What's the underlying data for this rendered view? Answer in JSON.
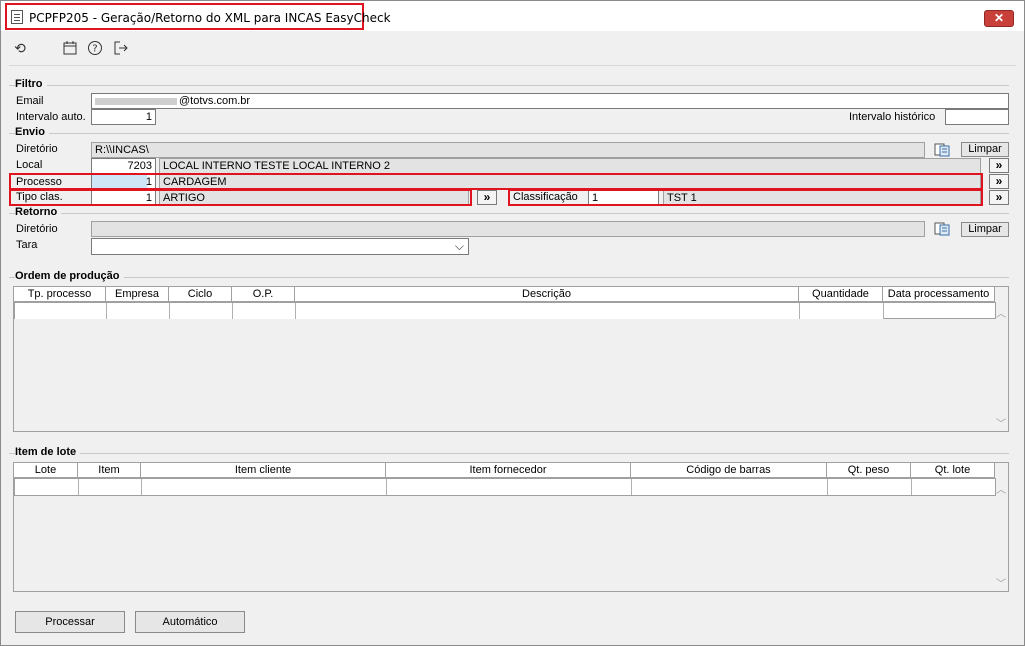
{
  "window": {
    "title": "PCPFP205 - Geração/Retorno do XML para INCAS EasyCheck"
  },
  "toolbar": {
    "refresh_icon": "refresh-icon",
    "calendar_icon": "calendar-icon",
    "help_icon": "help-icon",
    "exit_icon": "exit-icon"
  },
  "filtro": {
    "title": "Filtro",
    "email_label": "Email",
    "email_value": "@totvs.com.br",
    "intervalo_auto_label": "Intervalo auto.",
    "intervalo_auto_value": "1",
    "intervalo_historico_label": "Intervalo histórico",
    "intervalo_historico_value": ""
  },
  "envio": {
    "title": "Envio",
    "diretorio_label": "Diretório",
    "diretorio_value": "R:\\\\INCAS\\",
    "limpar_label": "Limpar",
    "local_label": "Local",
    "local_code": "7203",
    "local_desc": "LOCAL INTERNO TESTE LOCAL INTERNO 2",
    "processo_label": "Processo",
    "processo_code": "1",
    "processo_desc": "CARDAGEM",
    "tipo_clas_label": "Tipo clas.",
    "tipo_clas_code": "1",
    "tipo_clas_desc": "ARTIGO",
    "classificacao_label": "Classificação",
    "classificacao_code": "1",
    "classificacao_desc": "TST 1",
    "more_label": "»"
  },
  "retorno": {
    "title": "Retorno",
    "diretorio_label": "Diretório",
    "diretorio_value": "",
    "limpar_label": "Limpar",
    "tara_label": "Tara",
    "tara_value": "",
    "chevron": "⌵"
  },
  "ordem": {
    "title": "Ordem de produção",
    "columns": [
      "Tp. processo",
      "Empresa",
      "Ciclo",
      "O.P.",
      "Descrição",
      "Quantidade",
      "Data processamento"
    ]
  },
  "item_lote": {
    "title": "Item de lote",
    "columns": [
      "Lote",
      "Item",
      "Item cliente",
      "Item fornecedor",
      "Código de barras",
      "Qt. peso",
      "Qt. lote"
    ]
  },
  "footer": {
    "processar_label": "Processar",
    "automatico_label": "Automático"
  },
  "colors": {
    "highlight": "#e0141e",
    "close_button": "#c9403a"
  }
}
